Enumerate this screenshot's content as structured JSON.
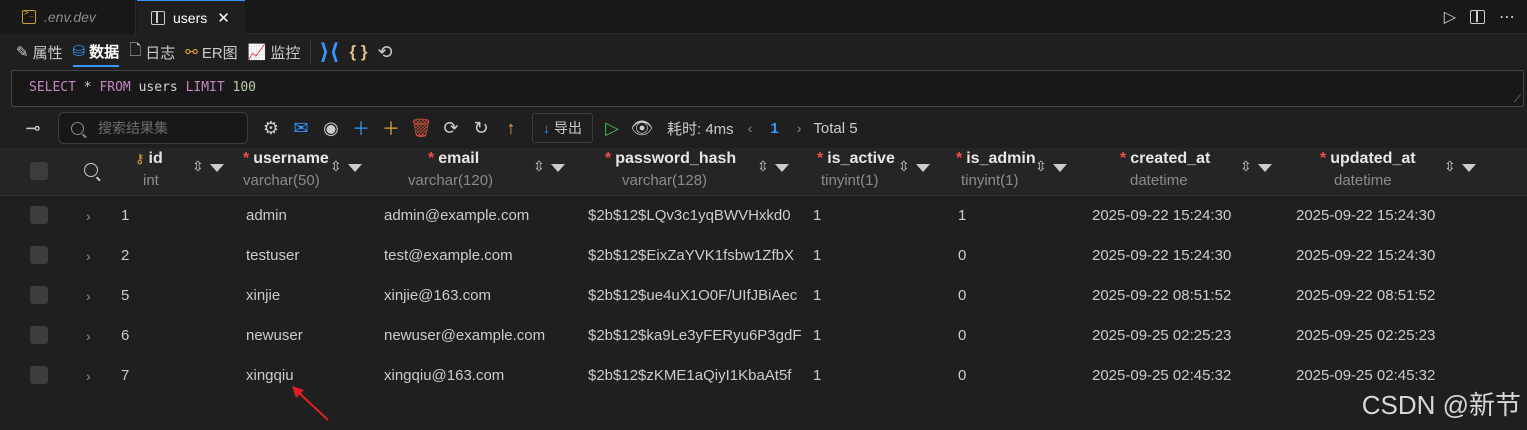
{
  "tabs": [
    {
      "label": ".env.dev"
    },
    {
      "label": "users",
      "close": "✕"
    }
  ],
  "view_toolbar": {
    "properties": "属性",
    "data": "数据",
    "log": "日志",
    "er": "ER图",
    "monitor": "监控"
  },
  "sql": {
    "select": "SELECT",
    "star": " * ",
    "from": "FROM",
    "table": " users ",
    "limit": "LIMIT",
    "count": "100"
  },
  "result_toolbar": {
    "search_placeholder": "搜索结果集",
    "export_label": "导出",
    "time_label": "耗时: 4ms",
    "page": "1",
    "total": "Total 5"
  },
  "columns": [
    {
      "name": "id",
      "type": "int",
      "required": false,
      "key": true
    },
    {
      "name": "username",
      "type": "varchar(50)",
      "required": true
    },
    {
      "name": "email",
      "type": "varchar(120)",
      "required": true
    },
    {
      "name": "password_hash",
      "type": "varchar(128)",
      "required": true
    },
    {
      "name": "is_active",
      "type": "tinyint(1)",
      "required": true
    },
    {
      "name": "is_admin",
      "type": "tinyint(1)",
      "required": true
    },
    {
      "name": "created_at",
      "type": "datetime",
      "required": true
    },
    {
      "name": "updated_at",
      "type": "datetime",
      "required": true
    }
  ],
  "rows": [
    [
      "1",
      "admin",
      "admin@example.com",
      "$2b$12$LQv3c1yqBWVHxkd0",
      "1",
      "1",
      "2025-09-22 15:24:30",
      "2025-09-22 15:24:30"
    ],
    [
      "2",
      "testuser",
      "test@example.com",
      "$2b$12$EixZaYVK1fsbw1ZfbX",
      "1",
      "0",
      "2025-09-22 15:24:30",
      "2025-09-22 15:24:30"
    ],
    [
      "5",
      "xinjie",
      "xinjie@163.com",
      "$2b$12$ue4uX1O0F/UIfJBiAec",
      "1",
      "0",
      "2025-09-22 08:51:52",
      "2025-09-22 08:51:52"
    ],
    [
      "6",
      "newuser",
      "newuser@example.com",
      "$2b$12$ka9Le3yFERyu6P3gdF",
      "1",
      "0",
      "2025-09-25 02:25:23",
      "2025-09-25 02:25:23"
    ],
    [
      "7",
      "xingqiu",
      "xingqiu@163.com",
      "$2b$12$zKME1aQiyI1KbaAt5f",
      "1",
      "0",
      "2025-09-25 02:45:32",
      "2025-09-25 02:45:32"
    ]
  ],
  "watermark": "CSDN @新节",
  "colors": {
    "accent": "#3794ff",
    "required": "#f14c4c",
    "annotation": "#e02020"
  }
}
